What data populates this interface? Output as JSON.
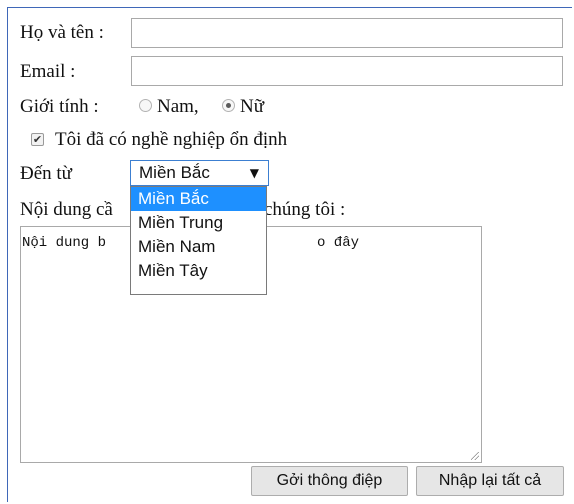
{
  "form": {
    "name_label": "Họ và tên :",
    "name_value": "",
    "email_label": "Email :",
    "email_value": "",
    "gender_label": "Giới tính :",
    "gender_options": [
      {
        "label": "Nam,",
        "checked": false
      },
      {
        "label": "Nữ",
        "checked": true
      }
    ],
    "employment_checkbox": {
      "label": "Tôi đã có nghề nghiệp ổn định",
      "checked": true
    },
    "origin_label": "Đến từ",
    "origin_select": {
      "selected": "Miền Bắc",
      "expanded": true,
      "arrow_icon": "triangle-down-icon",
      "options": [
        "Miền Bắc",
        "Miền Trung",
        "Miền Nam",
        "Miền Tây"
      ]
    },
    "message_label_left": "Nội dung cầ",
    "message_label_right": "chúng tôi :",
    "message_value_left": "Nội dung b",
    "message_value_right": "o đây",
    "buttons": {
      "submit": "Gởi thông điệp",
      "reset": "Nhập lại tất cả"
    }
  },
  "colors": {
    "frame_border": "#3f67b8",
    "select_focus_border": "#3c7fd1",
    "option_highlight": "#1e90ff",
    "button_bg": "#e6e6e6"
  }
}
